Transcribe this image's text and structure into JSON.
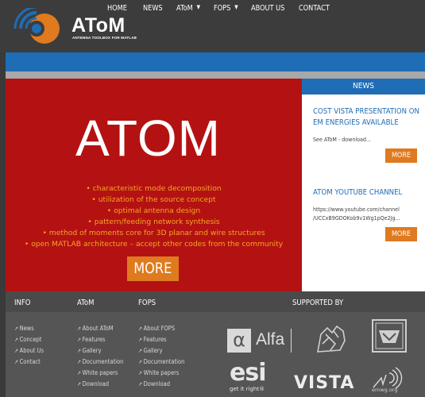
{
  "header": {
    "brand": "AToM",
    "tagline": "ANTENNA TOOLBOX FOR MATLAB"
  },
  "nav": {
    "items": [
      {
        "label": "HOME"
      },
      {
        "label": "NEWS"
      },
      {
        "label": "AToM",
        "caret": "▼"
      },
      {
        "label": "FOPS",
        "caret": "▼"
      },
      {
        "label": "ABOUT US"
      },
      {
        "label": "CONTACT"
      }
    ]
  },
  "hero": {
    "title": "ATOM",
    "features": [
      "• characteristic mode decomposition",
      "• utilization of the source concept",
      "• optimal antenna design",
      "• pattern/feeding network synthesis",
      "• method of moments core for 3D planar and wire structures",
      "• open MATLAB architecture – accept other codes from the community"
    ],
    "more_label": "MORE"
  },
  "news": {
    "header": "NEWS",
    "items": [
      {
        "title_line1": "COST VISTA PRESENTATION ON",
        "title_line2": "EM ENERGIES AVAILABLE",
        "text": "See AToM - download...",
        "more": "MORE"
      },
      {
        "title_line1": "ATOM YOUTUBE CHANNEL",
        "text_line1": "https://www.youtube.com/channel",
        "text_line2": "/UCCxB9GDOKob9v1Wg1pQe2Jg...",
        "more": "MORE"
      }
    ]
  },
  "footer": {
    "info": {
      "heading": "INFO",
      "links": [
        "News",
        "Concept",
        "About Us",
        "Contact"
      ]
    },
    "atom": {
      "heading": "AToM",
      "links": [
        "About AToM",
        "Features",
        "Gallery",
        "Documentation",
        "White papers",
        "Download"
      ]
    },
    "fops": {
      "heading": "FOPS",
      "links": [
        "About FOPS",
        "Features",
        "Gallery",
        "Documentation",
        "White papers",
        "Download"
      ]
    },
    "supported_by": {
      "heading": "SUPPORTED BY",
      "alfa": "Alfa",
      "alfa_symbol": "α",
      "esi": "esi",
      "esi_tagline": "get it right®",
      "vista": "VISTA",
      "emwg": "emwg.org"
    },
    "arrow": "↗"
  },
  "colors": {
    "nav_blue": "#1f6db5",
    "hero_red": "#b41212",
    "accent_orange": "#e07a1f",
    "feature_text": "#f5a623"
  }
}
